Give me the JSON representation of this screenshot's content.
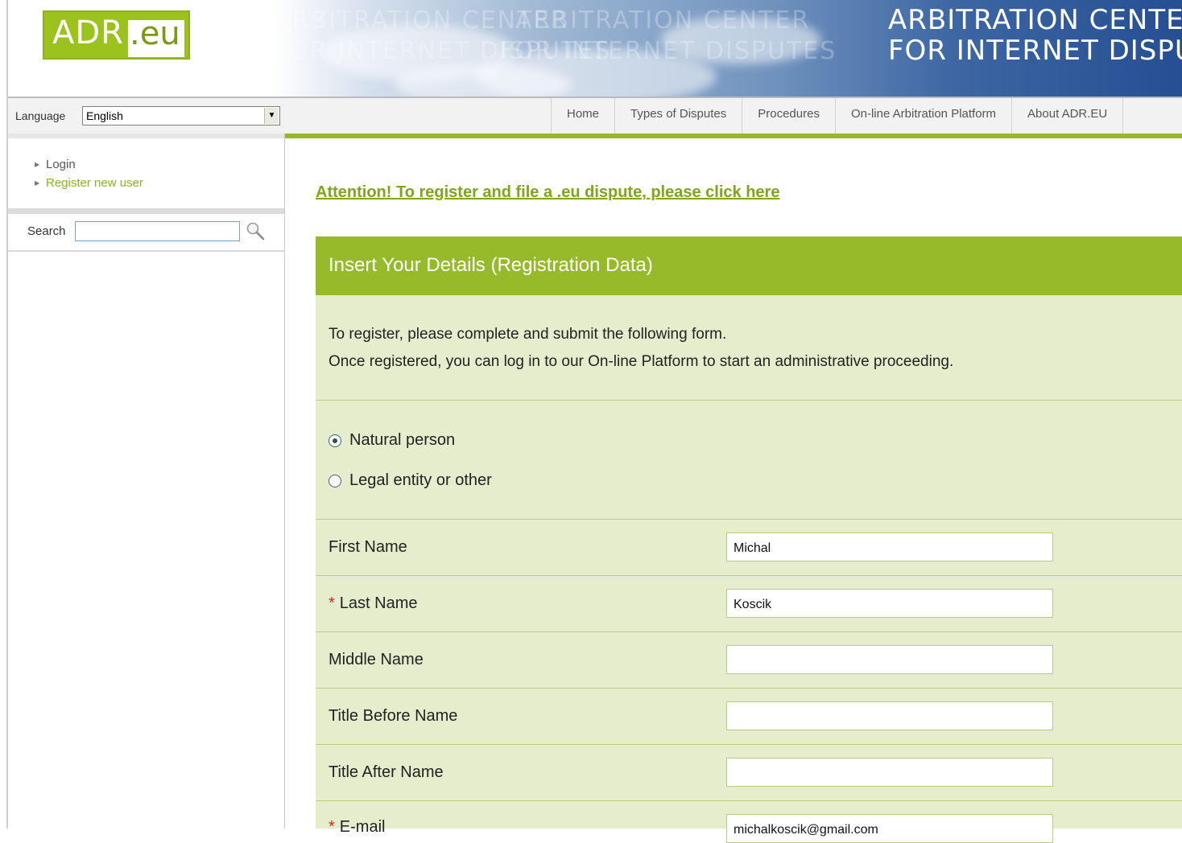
{
  "header": {
    "logo_primary": "ADR",
    "logo_suffix": ".eu",
    "banner_line1": "ARBITRATION CENTER",
    "banner_line2": "FOR INTERNET DISPUTE",
    "ghost_text_1": "ARBITRATION CENTER",
    "ghost_text_2": "FOR INTERNET DISPUTES"
  },
  "topbar": {
    "language_label": "Language",
    "language_selected": "English",
    "nav": [
      {
        "label": "Home"
      },
      {
        "label": "Types of Disputes"
      },
      {
        "label": "Procedures"
      },
      {
        "label": "On-line Arbitration Platform"
      },
      {
        "label": "About ADR.EU"
      }
    ]
  },
  "sidebar": {
    "links": [
      {
        "label": "Login",
        "color": "#555555"
      },
      {
        "label": "Register new user",
        "color": "#8ab31e"
      }
    ],
    "search_label": "Search",
    "search_value": ""
  },
  "main": {
    "attention_link": "Attention! To register and file a .eu dispute, please click here",
    "form_title": "Insert Your Details (Registration Data)",
    "intro_line1": "To register, please complete and submit the following form.",
    "intro_line2": "Once registered, you can log in to our On-line Platform to start an administrative proceeding.",
    "person_type": [
      {
        "label": "Natural person",
        "checked": true
      },
      {
        "label": "Legal entity or other",
        "checked": false
      }
    ],
    "fields": [
      {
        "label": "First Name",
        "required": false,
        "value": "Michal"
      },
      {
        "label": "Last Name",
        "required": true,
        "value": "Koscik"
      },
      {
        "label": "Middle Name",
        "required": false,
        "value": ""
      },
      {
        "label": "Title Before Name",
        "required": false,
        "value": ""
      },
      {
        "label": "Title After Name",
        "required": false,
        "value": ""
      },
      {
        "label": "E-mail",
        "required": true,
        "value": "michalkoscik@gmail.com"
      }
    ],
    "required_marker": "*"
  },
  "colors": {
    "brand_green": "#97ba2a",
    "form_bg": "#e5edcd",
    "link_green": "#7fa518",
    "required_red": "#e02020"
  }
}
